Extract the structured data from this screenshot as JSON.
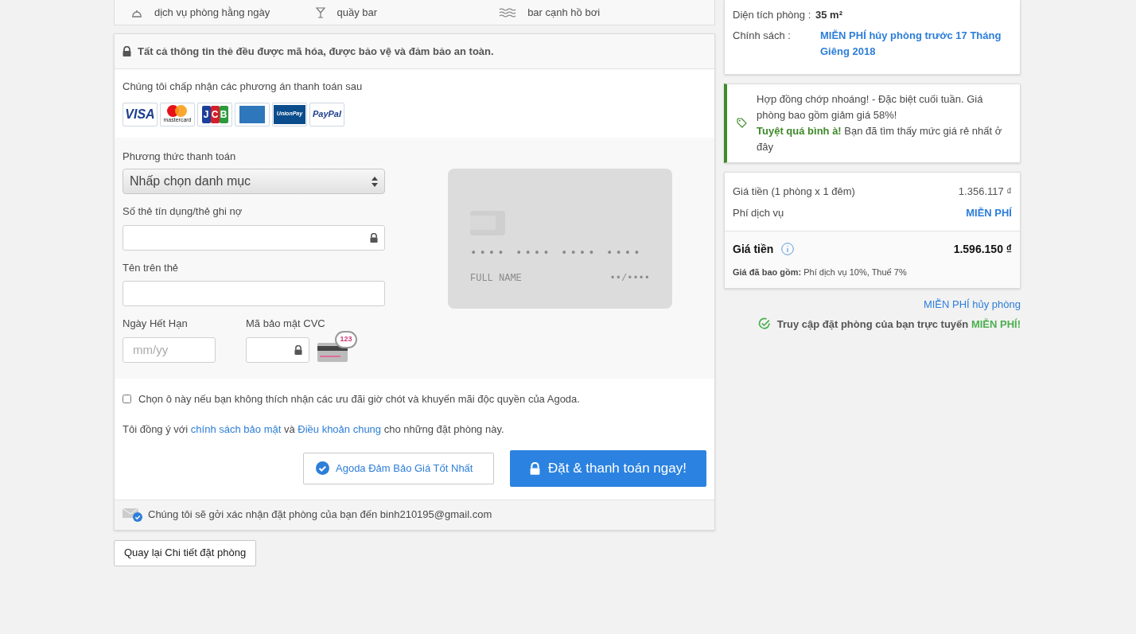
{
  "amenities": [
    {
      "kind": "room-service",
      "label": "dịch vụ phòng hằng ngày"
    },
    {
      "kind": "bar",
      "label": "quầy bar"
    },
    {
      "kind": "pool",
      "label": "bar cạnh hồ bơi"
    }
  ],
  "payment": {
    "security_note": "Tất cả thông tin thẻ đều được mã hóa, được bảo vệ và đảm bảo an toàn.",
    "accepted_title": "Chúng tôi chấp nhận các phương án thanh toán sau",
    "card_logos": [
      {
        "kind": "visa",
        "label": "VISA"
      },
      {
        "kind": "mastercard",
        "label": "mastercard"
      },
      {
        "kind": "jcb",
        "label": "JCB"
      },
      {
        "kind": "amex"
      },
      {
        "kind": "unionpay",
        "label": "UnionPay"
      },
      {
        "kind": "paypal",
        "label": "PayPal"
      }
    ],
    "method_label": "Phương thức thanh toán",
    "method_value": "Nhấp chọn danh mục",
    "card_number_label": "Số thẻ tín dụng/thẻ ghi nợ",
    "name_label": "Tên trên thẻ",
    "expiry_label": "Ngày Hết Hạn",
    "expiry_placeholder": "mm/yy",
    "cvc_label": "Mã bảo mật CVC",
    "cvc_badge": "123",
    "preview": {
      "number": "•••• •••• •••• ••••",
      "name": "FULL NAME",
      "expiry": "••/••••"
    }
  },
  "opt_out": {
    "checked": false,
    "text": "Chọn ô này nếu bạn không thích nhận các ưu đãi giờ chót và khuyến mãi độc quyền của Agoda."
  },
  "terms": [
    {
      "kind": "text",
      "text": "Tôi đồng ý với "
    },
    {
      "kind": "link",
      "text": "chính sách bảo mật"
    },
    {
      "kind": "text",
      "text": " và "
    },
    {
      "kind": "link",
      "text": "Điều khoản chung"
    },
    {
      "kind": "text",
      "text": " cho những đặt phòng này."
    }
  ],
  "guarantee": "Agoda Đảm Bảo Giá Tốt Nhất",
  "book_button": "Đặt & thanh toán ngay!",
  "confirmation": "Chúng tôi sẽ gởi xác nhận đặt phòng của bạn đến binh210195@gmail.com",
  "back_button": "Quay lại Chi tiết đặt phòng",
  "room": [
    {
      "kind": "plain",
      "label": "Diện tích phòng :",
      "value": "35 m²"
    },
    {
      "kind": "link",
      "label": "Chính sách :",
      "value": "MIỄN PHÍ hủy phòng trước 17 Tháng Giêng 2018"
    }
  ],
  "deal": [
    "Hợp đồng chớp nhoáng! - Đặc biệt cuối tuần. Giá phòng bao gồm giảm giá 58%!",
    "**Tuyệt quá bình à!** Bạn đã tìm thấy mức giá rẻ nhất ở đây"
  ],
  "price": {
    "rows": [
      {
        "kind": "amount",
        "label": "Giá tiền (1 phòng x 1 đêm)",
        "value": "1.356.117 ₫"
      },
      {
        "kind": "free",
        "label": "Phí dịch vụ",
        "value": "MIỄN PHÍ"
      }
    ],
    "total_label": "Giá tiền",
    "total_value": "1.596.150 ₫",
    "note": "**Giá đã bao gồm:** Phí dịch vụ 10%, Thuế 7%"
  },
  "free_cancel": "MIỄN PHÍ hủy phòng",
  "online_access": "Truy cập đặt phòng của bạn trực tuyến **MIỄN PHÍ!**"
}
